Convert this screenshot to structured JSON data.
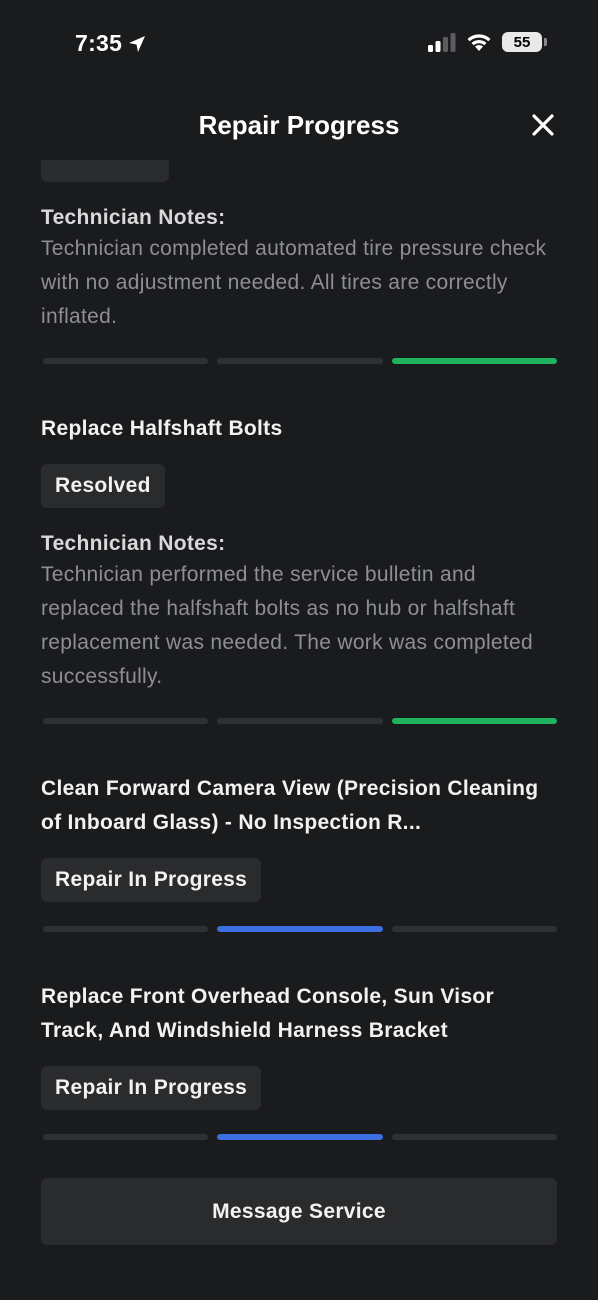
{
  "status_bar": {
    "time": "7:35",
    "battery": "55"
  },
  "header": {
    "title": "Repair Progress"
  },
  "items": [
    {
      "notes_label": "Technician Notes:",
      "notes": "Technician completed automated tire pressure check with no adjustment needed. All tires are correctly inflated.",
      "progress_stage": 3,
      "progress_color": "#22b15c"
    },
    {
      "title": "Replace Halfshaft Bolts",
      "status": "Resolved",
      "notes_label": "Technician Notes:",
      "notes": "Technician performed the service bulletin and replaced the halfshaft bolts as no hub or halfshaft replacement was needed. The work was completed successfully.",
      "progress_stage": 3,
      "progress_color": "#22b15c"
    },
    {
      "title": "Clean Forward Camera View (Precision Cleaning of Inboard Glass) - No Inspection R...",
      "status": "Repair In Progress",
      "progress_stage": 2,
      "progress_color": "#3d6ee0"
    },
    {
      "title": "Replace Front Overhead Console,  Sun Visor Track, And Windshield Harness Bracket",
      "status": "Repair In Progress",
      "progress_stage": 2,
      "progress_color": "#3d6ee0"
    }
  ],
  "footer": {
    "button_label": "Message Service"
  },
  "icons": {
    "location": "location-arrow-icon",
    "signal": "cellular-signal-icon",
    "wifi": "wifi-icon",
    "battery": "battery-icon",
    "close": "close-icon"
  }
}
